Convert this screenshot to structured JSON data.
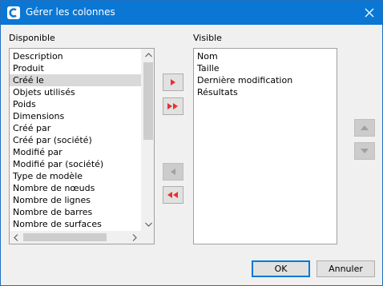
{
  "window": {
    "title": "Gérer les colonnes",
    "app_icon": "app-logo-icon",
    "close_icon": "close-icon"
  },
  "available": {
    "label": "Disponible",
    "items": [
      "Description",
      "Produit",
      "Créé le",
      "Objets utilisés",
      "Poids",
      "Dimensions",
      "Créé par",
      "Créé par (société)",
      "Modifié par",
      "Modifié par (société)",
      "Type de modèle",
      "Nombre de nœuds",
      "Nombre de lignes",
      "Nombre de barres",
      "Nombre de surfaces"
    ],
    "selected_index": 2
  },
  "visible": {
    "label": "Visible",
    "items": [
      "Nom",
      "Taille",
      "Dernière modification",
      "Résultats"
    ]
  },
  "transfer_buttons": {
    "add_one_icon": "arrow-right-icon",
    "add_all_icon": "double-arrow-right-icon",
    "remove_one_icon": "arrow-left-icon",
    "remove_all_icon": "double-arrow-left-icon"
  },
  "order_buttons": {
    "up_icon": "arrow-up-icon",
    "down_icon": "arrow-down-icon"
  },
  "footer": {
    "ok_label": "OK",
    "cancel_label": "Annuler"
  },
  "colors": {
    "titlebar": "#0a77d4",
    "accent_arrow": "#e8312f",
    "disabled_arrow": "#a0a0a0",
    "selection": "#d9d9d9"
  }
}
